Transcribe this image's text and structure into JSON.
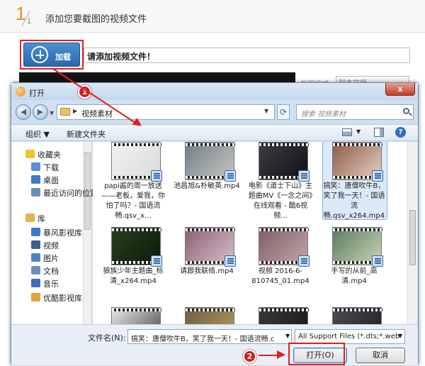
{
  "header": {
    "step_current": "1",
    "step_total": "1",
    "title": "添加您要截图的视频文件"
  },
  "add_button": {
    "label": "加载"
  },
  "file_input": {
    "value": "请添加视频文件！"
  },
  "behind": {
    "label": "截图模式",
    "select_value": "副本文档"
  },
  "dialog": {
    "title": "打开",
    "close_symbol": "x",
    "address": {
      "crumb": "视频素材"
    },
    "search": {
      "placeholder": "搜索 视频素材"
    },
    "toolbar": {
      "organize": "组织 ▼",
      "new_folder": "新建文件夹"
    },
    "nav": {
      "items": [
        {
          "label": "收藏夹",
          "icon": "star-icon",
          "color": "#f3c230"
        },
        {
          "label": "下载",
          "icon": "download-folder-icon",
          "color": "#5b8fd6"
        },
        {
          "label": "桌面",
          "icon": "desktop-icon",
          "color": "#3f79c2"
        },
        {
          "label": "最近访问的位置",
          "icon": "recent-places-icon",
          "color": "#6c8db5"
        },
        {
          "label": "库",
          "icon": "library-icon",
          "color": "#e2b54a"
        },
        {
          "label": "暴风影视库",
          "icon": "video-library-icon",
          "color": "#3c79c7"
        },
        {
          "label": "视频",
          "icon": "video-folder-icon",
          "color": "#3c5f8f"
        },
        {
          "label": "图片",
          "icon": "pictures-folder-icon",
          "color": "#4c84c9"
        },
        {
          "label": "文档",
          "icon": "documents-folder-icon",
          "color": "#6d8fb8"
        },
        {
          "label": "音乐",
          "icon": "music-folder-icon",
          "color": "#3f6fb5"
        },
        {
          "label": "优酷影视库",
          "icon": "video-library-icon",
          "color": "#e4a23a"
        }
      ]
    },
    "files": [
      {
        "name": "papi酱的周一放送——老板，爱我，你怕了吗？- 国语流畅.qsv_x...",
        "colors": [
          "#f4f4f4",
          "#d8d8d8"
        ]
      },
      {
        "name": "池昌旭&朴敏英.mp4",
        "colors": [
          "#6e7d86",
          "#c9c9c4"
        ]
      },
      {
        "name": "电影《道士下山》主题曲MV《一念之间》在线观看 - 酷6视频...",
        "colors": [
          "#3b3d46",
          "#121212"
        ]
      },
      {
        "name": "搞笑：唐僧吹牛B，笑了我一天！- 国语流畅.qsv_x264.mp4",
        "colors": [
          "#8c5a44",
          "#e6d2c5"
        ],
        "selected": true
      },
      {
        "name": "狼族少年主题曲_标清_x264.mp4",
        "colors": [
          "#2a3f1f",
          "#0d1a0a"
        ]
      },
      {
        "name": "请跟我联络.mp4",
        "colors": [
          "#8a5f74",
          "#d7c1ca"
        ]
      },
      {
        "name": "视频 2016-6-810745_01.mp4",
        "colors": [
          "#7c5e63",
          "#c3a7ad"
        ]
      },
      {
        "name": "手写的从前_高清.mp4",
        "colors": [
          "#5b7a62",
          "#c8d5b3"
        ]
      },
      {
        "name": "",
        "colors": [
          "#e9e9e9",
          "#444"
        ]
      },
      {
        "name": "",
        "colors": [
          "#6b5f3e",
          "#b89f66"
        ]
      },
      {
        "name": "",
        "colors": [
          "#3a3a3a",
          "#151515"
        ]
      },
      {
        "name": "",
        "colors": [
          "#4e4e55",
          "#1a1a1f"
        ]
      }
    ],
    "filename_label": "文件名(N):",
    "filename_value": "搞笑：唐僧吹牛B，笑了我一天！- 国语流畅.c",
    "filetype_value": "All Support Files (*.dts;*.web",
    "open_label": "打开(O)",
    "cancel_label": "取消"
  },
  "annotations": {
    "badge1": "1",
    "badge2": "2",
    "color": "#e02020"
  }
}
